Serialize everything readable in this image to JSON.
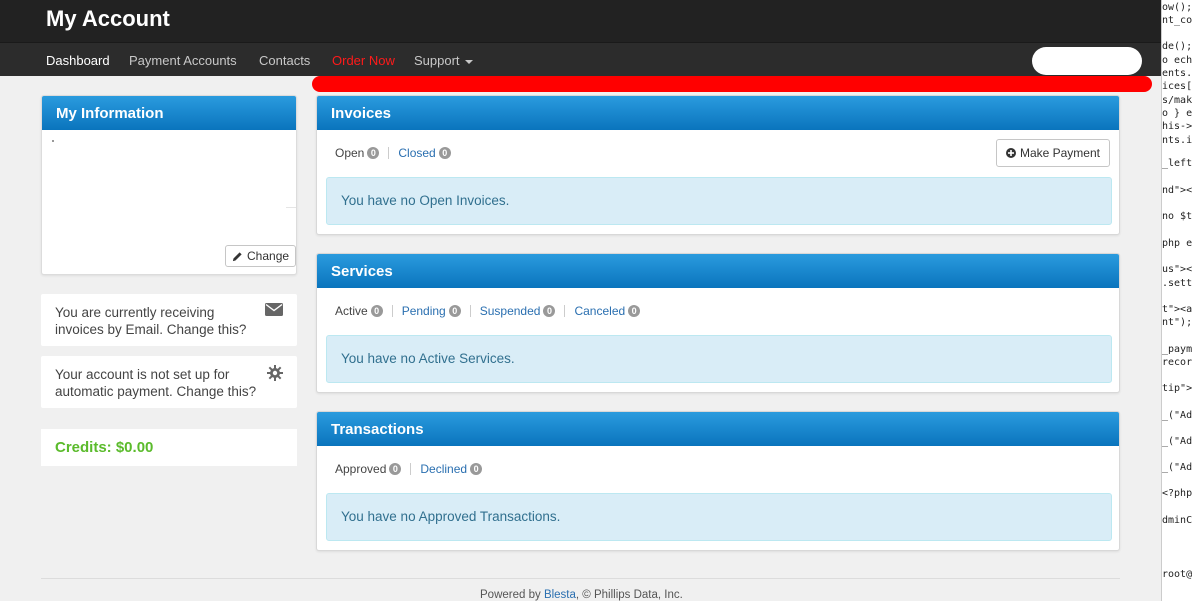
{
  "header": {
    "title": "My Account"
  },
  "nav": {
    "items": [
      {
        "label": "Dashboard"
      },
      {
        "label": "Payment Accounts"
      },
      {
        "label": "Contacts"
      },
      {
        "label": "Order Now"
      },
      {
        "label": "Support"
      }
    ]
  },
  "sidebar": {
    "info_title": "My Information",
    "change_label": "Change",
    "email_notice": "You are currently receiving invoices by Email. Change this?",
    "autopay_notice": "Your account is not set up for automatic payment. Change this?",
    "credits": "Credits: $0.00"
  },
  "invoices": {
    "title": "Invoices",
    "tabs": [
      {
        "label": "Open",
        "count": "0"
      },
      {
        "label": "Closed",
        "count": "0"
      }
    ],
    "action_label": "Make Payment",
    "message": "You have no Open Invoices."
  },
  "services": {
    "title": "Services",
    "tabs": [
      {
        "label": "Active",
        "count": "0"
      },
      {
        "label": "Pending",
        "count": "0"
      },
      {
        "label": "Suspended",
        "count": "0"
      },
      {
        "label": "Canceled",
        "count": "0"
      }
    ],
    "message": "You have no Active Services."
  },
  "transactions": {
    "title": "Transactions",
    "tabs": [
      {
        "label": "Approved",
        "count": "0"
      },
      {
        "label": "Declined",
        "count": "0"
      }
    ],
    "message": "You have no Approved Transactions."
  },
  "footer": {
    "prefix": "Powered by ",
    "link": "Blesta",
    "suffix": ", © Phillips Data, Inc."
  },
  "code_lines": [
    "ow();",
    "nt_co",
    "de();",
    "o ech",
    "ents.",
    "ices[",
    "s/mak",
    "o } e",
    "his->",
    "nts.i",
    "_left",
    "nd\"><",
    "no $t",
    "php e",
    "us\"><",
    ".sett",
    "t\"><a",
    "nt\");",
    "_paym",
    "recor",
    "tip\">",
    "_(\"Ad",
    "_(\"Ad",
    "_(\"Ad",
    "<?php",
    "dminC",
    "root@"
  ],
  "colors": {
    "accent": "#0a74bd",
    "credits": "#5bbb2c",
    "order_now": "#ff1a1a"
  }
}
